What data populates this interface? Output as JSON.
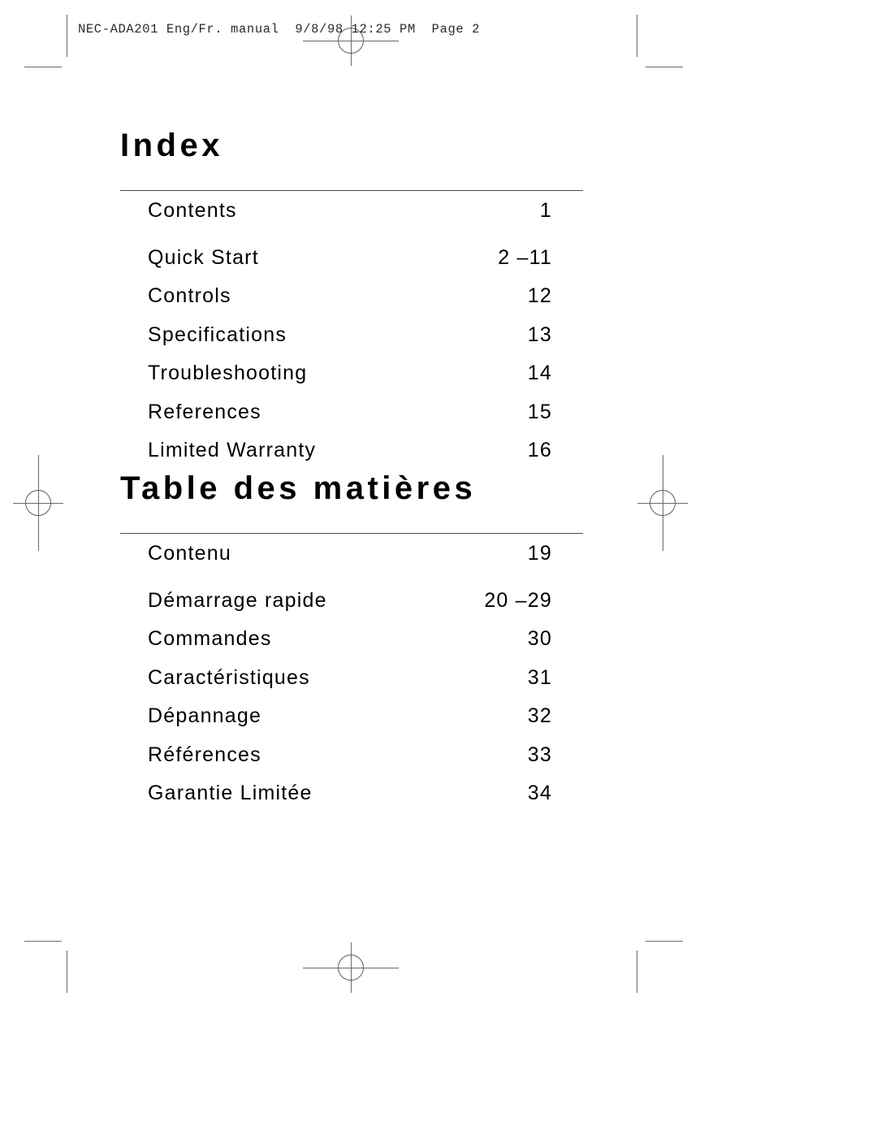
{
  "header": {
    "slug": "NEC-ADA201 Eng/Fr. manual  9/8/98 12:25 PM  Page 2"
  },
  "sections": [
    {
      "title": "Index",
      "entries": [
        {
          "label": "Contents",
          "page": "1"
        },
        {
          "label": "Quick Start",
          "page": "2 –11"
        },
        {
          "label": "Controls",
          "page": "12"
        },
        {
          "label": "Specifications",
          "page": "13"
        },
        {
          "label": "Troubleshooting",
          "page": "14"
        },
        {
          "label": "References",
          "page": "15"
        },
        {
          "label": "Limited Warranty",
          "page": "16"
        }
      ]
    },
    {
      "title": "Table des matières",
      "entries": [
        {
          "label": "Contenu",
          "page": "19"
        },
        {
          "label": "Démarrage rapide",
          "page": "20 –29"
        },
        {
          "label": "Commandes",
          "page": "30"
        },
        {
          "label": "Caractéristiques",
          "page": "31"
        },
        {
          "label": "Dépannage",
          "page": "32"
        },
        {
          "label": "Références",
          "page": "33"
        },
        {
          "label": "Garantie Limitée",
          "page": "34"
        }
      ]
    }
  ],
  "colors": {
    "text": "#000000",
    "rule": "#4a4a4a",
    "crop_mark": "#6b6b6b",
    "page_background": "#ffffff"
  }
}
